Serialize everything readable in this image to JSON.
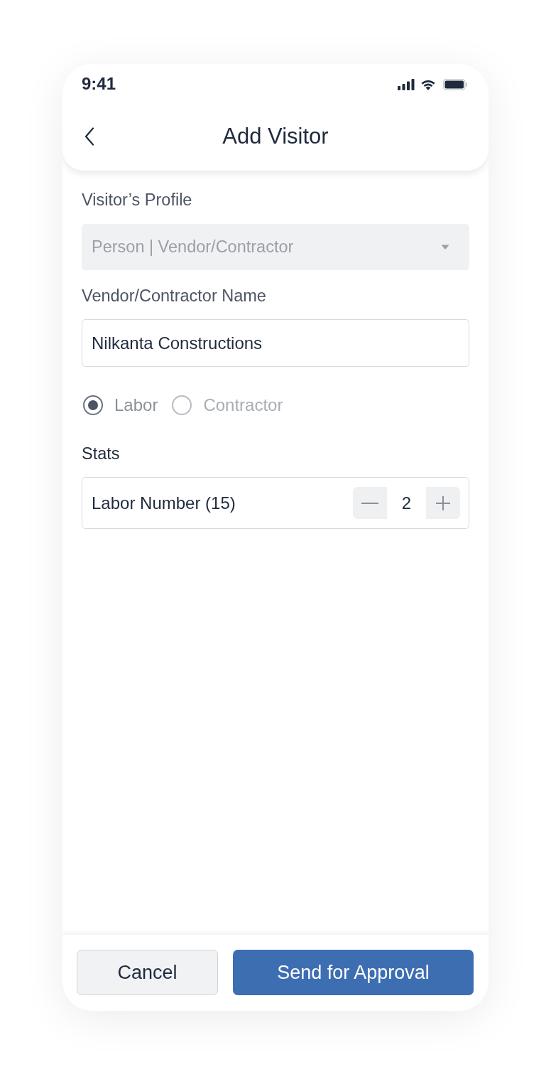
{
  "status_bar": {
    "time": "9:41"
  },
  "header": {
    "title": "Add Visitor"
  },
  "form": {
    "profile": {
      "label": "Visitor’s Profile",
      "value": "Person | Vendor/Contractor",
      "disabled": true
    },
    "vendor_name": {
      "label": "Vendor/Contractor Name",
      "value": "Nilkanta Constructions"
    },
    "visitor_type": [
      {
        "label": "Labor",
        "selected": true
      },
      {
        "label": "Contractor",
        "selected": false
      }
    ],
    "stats": {
      "label": "Stats",
      "counters": [
        {
          "label": "Labor Number (15)",
          "value": "2"
        }
      ]
    }
  },
  "footer": {
    "buttons": [
      {
        "label": "Cancel",
        "kind": "secondary"
      },
      {
        "label": "Send for Approval",
        "kind": "primary"
      }
    ]
  }
}
